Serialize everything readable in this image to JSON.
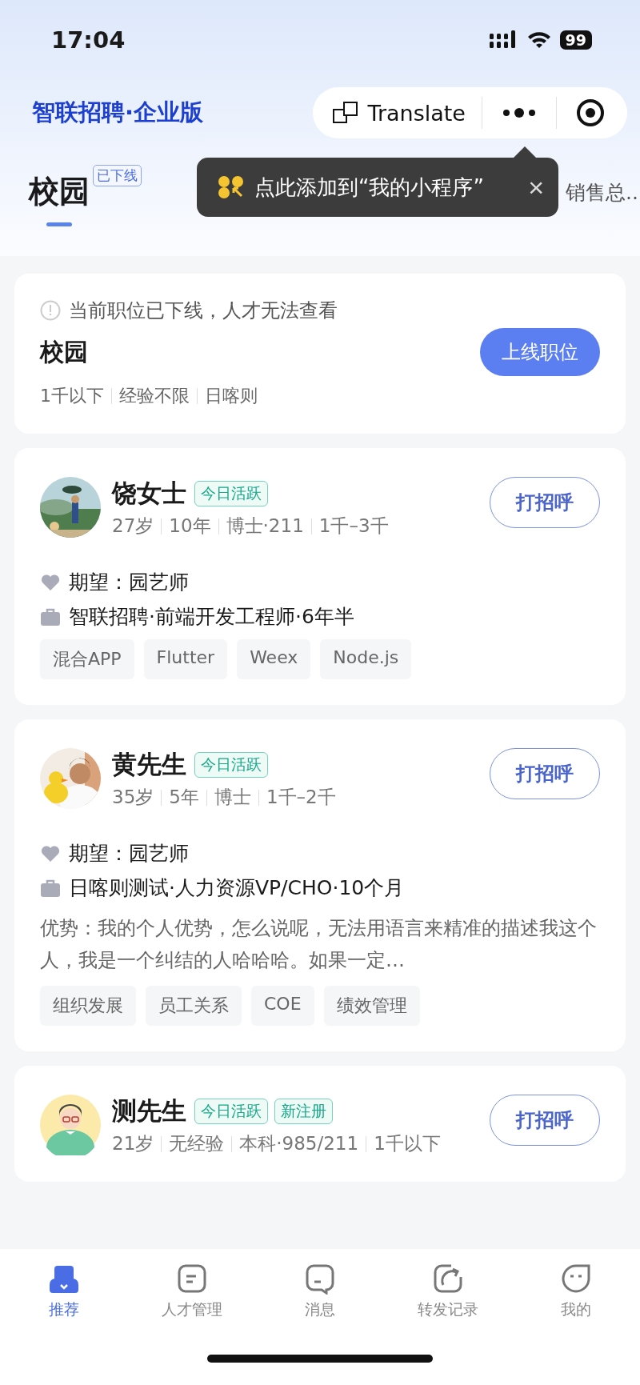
{
  "status_bar": {
    "time": "17:04",
    "battery": "99"
  },
  "header": {
    "logo": "智联招聘·企业版",
    "capsule": {
      "translate": "Translate"
    }
  },
  "tabs": [
    {
      "label": "校园",
      "badge": "已下线",
      "selected": true
    },
    {
      "label": "销售总..",
      "selected": false
    }
  ],
  "tooltip": {
    "text": "点此添加到“我的小程序”",
    "close": "×"
  },
  "job_card": {
    "notice": "当前职位已下线，人才无法查看",
    "title": "校园",
    "meta": [
      "1千以下",
      "经验不限",
      "日喀则"
    ],
    "button": "上线职位"
  },
  "candidates": [
    {
      "kind": "picture",
      "name": "饶女士",
      "badges": [
        "今日活跃"
      ],
      "meta": [
        "27岁",
        "10年",
        "博士·211",
        "1千–3千"
      ],
      "expectation": "期望：园艺师",
      "experience": "智联招聘·前端开发工程师·6年半",
      "tags": [
        "混合APP",
        "Flutter",
        "Weex",
        "Node.js"
      ],
      "button": "打招呼"
    },
    {
      "kind": "picture",
      "name": "黄先生",
      "badges": [
        "今日活跃"
      ],
      "meta": [
        "35岁",
        "5年",
        "博士",
        "1千–2千"
      ],
      "expectation": "期望：园艺师",
      "experience": "日喀则测试·人力资源VP/CHO·10个月",
      "advantage": "优势：我的个人优势，怎么说呢，无法用语言来精准的描述我这个人，我是一个纠结的人哈哈哈。如果一定…",
      "tags": [
        "组织发展",
        "员工关系",
        "COE",
        "绩效管理"
      ],
      "button": "打招呼"
    },
    {
      "kind": "avatar",
      "name": "测先生",
      "badges": [
        "今日活跃",
        "新注册"
      ],
      "meta": [
        "21岁",
        "无经验",
        "本科·985/211",
        "1千以下"
      ],
      "button": "打招呼"
    }
  ],
  "bottom_nav": [
    {
      "label": "推荐",
      "selected": true
    },
    {
      "label": "人才管理",
      "selected": false
    },
    {
      "label": "消息",
      "selected": false
    },
    {
      "label": "转发记录",
      "selected": false
    },
    {
      "label": "我的",
      "selected": false
    }
  ]
}
